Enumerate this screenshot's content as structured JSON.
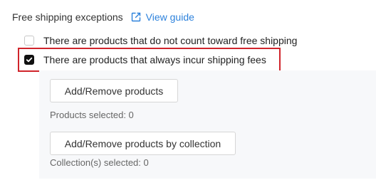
{
  "header": {
    "title": "Free shipping exceptions",
    "guide_link": "View guide",
    "guide_icon": "external-link-icon",
    "link_color": "#2d82dc"
  },
  "options": [
    {
      "label": "There are products that do not count toward free shipping",
      "checked": false
    },
    {
      "label": "There are products that always incur shipping fees",
      "checked": true
    }
  ],
  "highlight_color": "#d0242b",
  "panel": {
    "add_products_button": "Add/Remove products",
    "products_selected": "Products selected: 0",
    "add_collection_button": "Add/Remove products by collection",
    "collections_selected": "Collection(s) selected: 0"
  }
}
